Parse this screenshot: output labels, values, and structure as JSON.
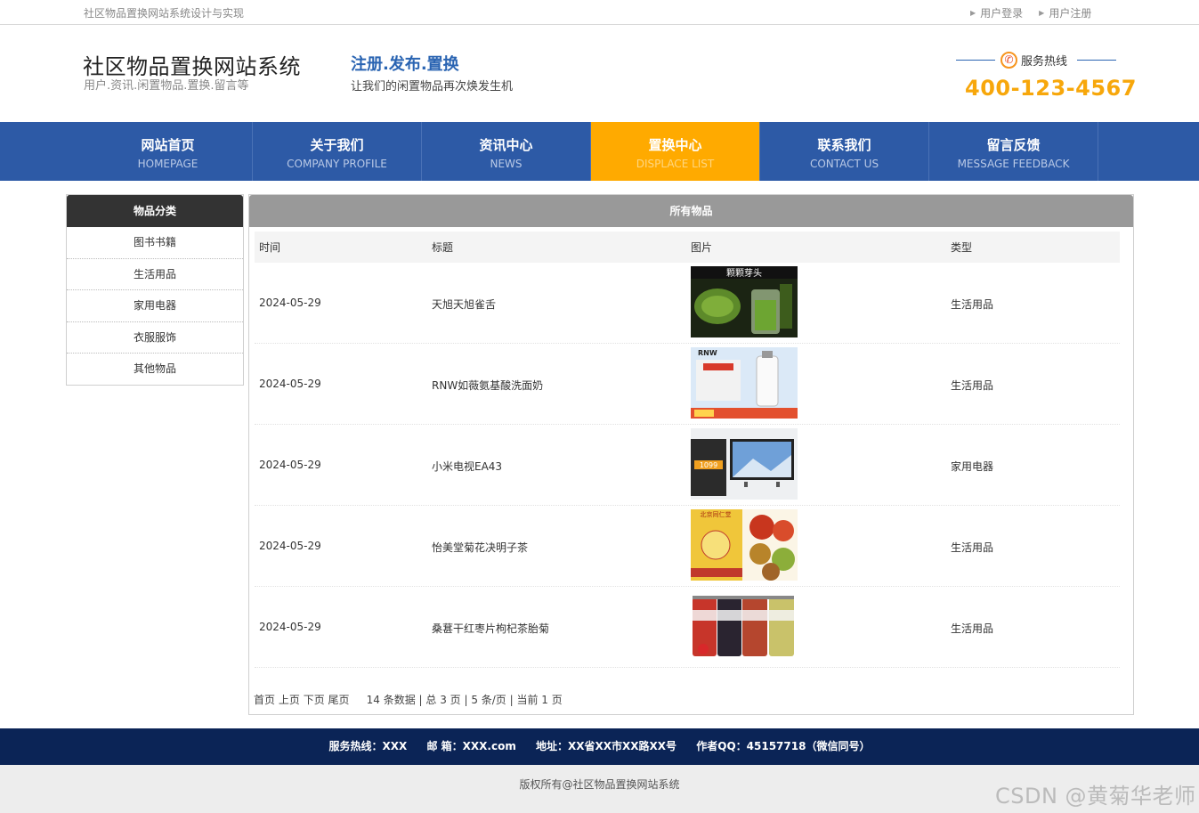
{
  "topbar": {
    "site_name": "社区物品置换网站系统设计与实现",
    "login_link": "用户登录",
    "register_link": "用户注册"
  },
  "header": {
    "logo_title": "社区物品置换网站系统",
    "logo_sub": "用户.资讯.闲置物品.置换.留言等",
    "slogan_title": "注册.发布.置换",
    "slogan_sub": "让我们的闲置物品再次焕发生机",
    "hotline_label": "服务热线",
    "hotline_number": "400-123-4567"
  },
  "nav": [
    {
      "zh": "网站首页",
      "en": "HOMEPAGE",
      "active": false
    },
    {
      "zh": "关于我们",
      "en": "COMPANY PROFILE",
      "active": false
    },
    {
      "zh": "资讯中心",
      "en": "NEWS",
      "active": false
    },
    {
      "zh": "置换中心",
      "en": "DISPLACE LIST",
      "active": true
    },
    {
      "zh": "联系我们",
      "en": "CONTACT US",
      "active": false
    },
    {
      "zh": "留言反馈",
      "en": "MESSAGE FEEDBACK",
      "active": false
    }
  ],
  "sidebar": {
    "title": "物品分类",
    "items": [
      "图书书籍",
      "生活用品",
      "家用电器",
      "衣服服饰",
      "其他物品"
    ]
  },
  "main": {
    "title": "所有物品",
    "columns": [
      "时间",
      "标题",
      "图片",
      "类型"
    ],
    "rows": [
      {
        "date": "2024-05-29",
        "title": "天旭天旭雀舌",
        "image": "tea-leaves-photo",
        "image_caption": "颗颗芽头",
        "type": "生活用品"
      },
      {
        "date": "2024-05-29",
        "title": "RNW如薇氨基酸洗面奶",
        "image": "cleanser-bottle-photo",
        "image_caption": "RNW",
        "type": "生活用品"
      },
      {
        "date": "2024-05-29",
        "title": "小米电视EA43",
        "image": "tv-photo",
        "image_caption": "1099",
        "type": "家用电器"
      },
      {
        "date": "2024-05-29",
        "title": "怡美堂菊花决明子茶",
        "image": "herbal-tea-box-photo",
        "image_caption": "北京同仁堂",
        "type": "生活用品"
      },
      {
        "date": "2024-05-29",
        "title": "桑葚干红枣片枸杞茶胎菊",
        "image": "dried-fruit-jars-photo",
        "image_caption": "",
        "type": "生活用品"
      }
    ],
    "pager": {
      "first": "首页",
      "prev": "上页",
      "next": "下页",
      "last": "尾页",
      "summary": "14 条数据 | 总 3 页 | 5 条/页 | 当前 1 页"
    }
  },
  "footer": {
    "hotline": "服务热线：XXX",
    "email": "邮 箱：XXX.com",
    "address": "地址：XX省XX市XX路XX号",
    "qq": "作者QQ：45157718（微信同号）",
    "copyright": "版权所有@社区物品置换网站系统"
  },
  "watermark": "CSDN @黄菊华老师",
  "colors": {
    "nav_bg": "#2d5aa6",
    "nav_active": "#ffaa00",
    "hotline": "#f7a70b",
    "footer_bg": "#0b2456"
  }
}
